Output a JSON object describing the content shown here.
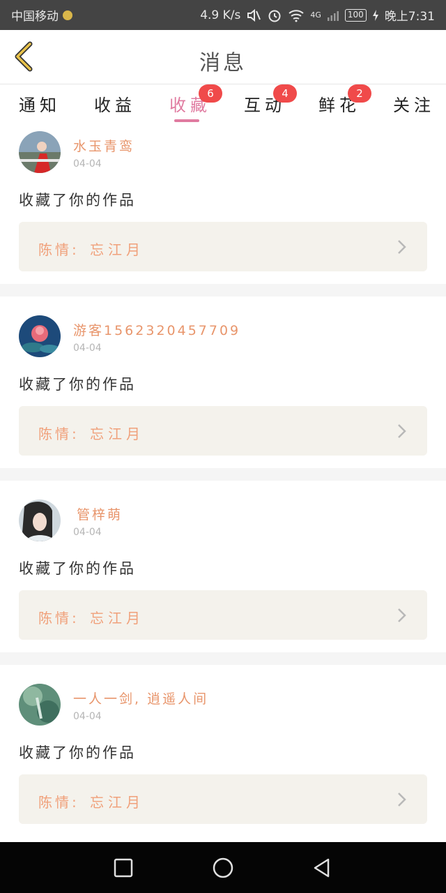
{
  "status_bar": {
    "carrier": "中国移动",
    "speed": "4.9 K/s",
    "network": "4G",
    "battery": "100",
    "time": "晚上7:31"
  },
  "header": {
    "title": "消息",
    "back_icon": "chevron-left-icon"
  },
  "tabs": [
    {
      "label": "通知",
      "badge": ""
    },
    {
      "label": "收益",
      "badge": ""
    },
    {
      "label": "收藏",
      "badge": "6",
      "active": true
    },
    {
      "label": "互动",
      "badge": "4"
    },
    {
      "label": "鲜花",
      "badge": "2"
    },
    {
      "label": "关注",
      "badge": ""
    }
  ],
  "items": [
    {
      "username": "水玉青鸾",
      "date": "04-04",
      "action": "收藏了你的作品",
      "work_label": "陈情:",
      "work_title": "忘江月"
    },
    {
      "username": "游客1562320457709",
      "date": "04-04",
      "action": "收藏了你的作品",
      "work_label": "陈情:",
      "work_title": "忘江月"
    },
    {
      "username": "管梓萌",
      "date": "04-04",
      "action": "收藏了你的作品",
      "work_label": "陈情:",
      "work_title": "忘江月"
    },
    {
      "username": "一人一剑, 逍遥人间",
      "date": "04-04",
      "action": "收藏了你的作品",
      "work_label": "陈情:",
      "work_title": "忘江月"
    }
  ],
  "colors": {
    "accent": "#e07ba0",
    "badge": "#f04a4a",
    "username": "#e8956b",
    "link_bg": "#f4f2ec"
  }
}
